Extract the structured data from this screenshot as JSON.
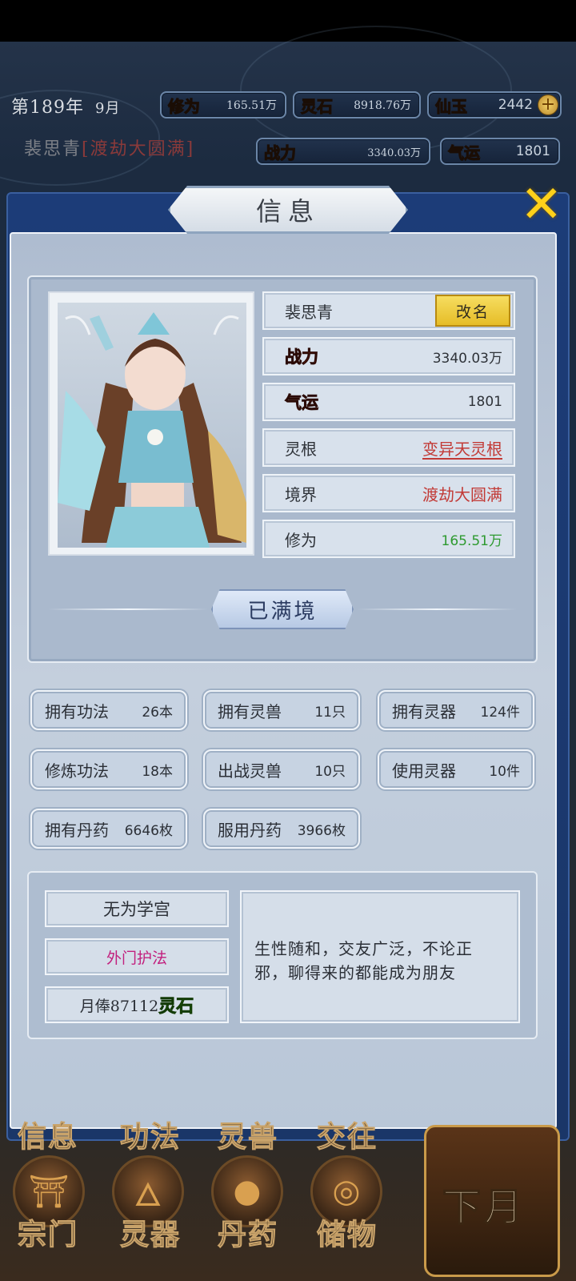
{
  "header": {
    "year": "第189年",
    "month": "9月",
    "cultivation": {
      "label": "修为",
      "value": "165.51万"
    },
    "spirit_stone": {
      "label": "灵石",
      "value": "8918.76万"
    },
    "immortal_jade": {
      "label": "仙玉",
      "value": "2442"
    },
    "power": {
      "label": "战力",
      "value": "3340.03万"
    },
    "luck": {
      "label": "气运",
      "value": "1801"
    },
    "character_name": "裴思青",
    "character_realm": "[渡劫大圆满]"
  },
  "dialog": {
    "title": "信息",
    "name": "裴思青",
    "rename_label": "改名",
    "power_label": "战力",
    "power_value": "3340.03万",
    "luck_label": "气运",
    "luck_value": "1801",
    "root_label": "灵根",
    "root_value": "变异天灵根",
    "realm_label": "境界",
    "realm_value": "渡劫大圆满",
    "cultivation_label": "修为",
    "cultivation_value": "165.51万",
    "realm_status": "已满境"
  },
  "stats": [
    {
      "label": "拥有功法",
      "value": "26本"
    },
    {
      "label": "拥有灵兽",
      "value": "11只"
    },
    {
      "label": "拥有灵器",
      "value": "124件"
    },
    {
      "label": "修炼功法",
      "value": "18本"
    },
    {
      "label": "出战灵兽",
      "value": "10只"
    },
    {
      "label": "使用灵器",
      "value": "10件"
    },
    {
      "label": "拥有丹药",
      "value": "6646枚"
    },
    {
      "label": "服用丹药",
      "value": "3966枚"
    }
  ],
  "sect": {
    "name": "无为学宫",
    "position": "外门护法",
    "salary_prefix": "月俸87112",
    "salary_unit": "灵石",
    "description": "生性随和，交友广泛，不论正邪，聊得来的都能成为朋友"
  },
  "bottom_nav": {
    "info": "信息",
    "skills": "功法",
    "beasts": "灵兽",
    "social": "交往",
    "sect": "宗门",
    "artifacts": "灵器",
    "pills": "丹药",
    "storage": "储物",
    "next_month": "下月"
  },
  "colors": {
    "panel_frame": "#1c3c78",
    "panel_body": "#c4cfdd",
    "rename_button": "#f6dd60",
    "close_icon": "#ffd11a"
  }
}
